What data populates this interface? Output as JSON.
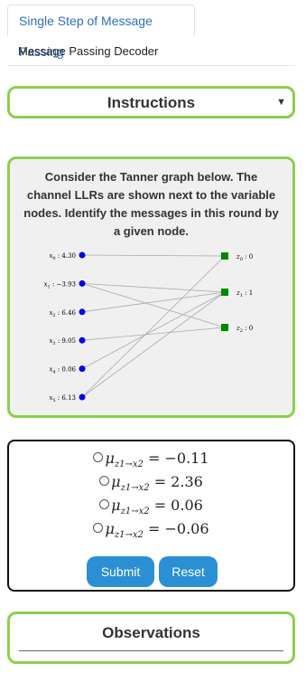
{
  "tabs": {
    "active": "Single Step of Message Passing",
    "inactive": "Message Passing Decoder"
  },
  "instructions": {
    "title": "Instructions"
  },
  "question": {
    "text": "Consider the Tanner graph below. The channel LLRs are shown next to the variable nodes. Identify the messages in this round by a given node."
  },
  "graph": {
    "variable_nodes": [
      {
        "label": "x",
        "sub": "0",
        "value": ": 4.30"
      },
      {
        "label": "x",
        "sub": "1",
        "value": ": −3.93"
      },
      {
        "label": "x",
        "sub": "2",
        "value": ": 6.46"
      },
      {
        "label": "x",
        "sub": "3",
        "value": ": 9.05"
      },
      {
        "label": "x",
        "sub": "4",
        "value": ": 0.06"
      },
      {
        "label": "x",
        "sub": "5",
        "value": ": 6.13"
      }
    ],
    "check_nodes": [
      {
        "label": "z",
        "sub": "0",
        "value": ": 0"
      },
      {
        "label": "z",
        "sub": "1",
        "value": ": 1"
      },
      {
        "label": "z",
        "sub": "2",
        "value": ": 0"
      }
    ],
    "edges": [
      [
        0,
        0
      ],
      [
        1,
        1
      ],
      [
        1,
        2
      ],
      [
        2,
        1
      ],
      [
        3,
        2
      ],
      [
        4,
        1
      ],
      [
        5,
        0
      ],
      [
        5,
        1
      ]
    ],
    "colors": {
      "variable": "#0000ee",
      "check": "#008800",
      "edge": "#aaaaaa"
    }
  },
  "answers": {
    "options": [
      {
        "prefix": "μ",
        "sub": "z1→x2",
        "value": "= −0.11"
      },
      {
        "prefix": "μ",
        "sub": "z1→x2",
        "value": "= 2.36"
      },
      {
        "prefix": "μ",
        "sub": "z1→x2",
        "value": "= 0.06"
      },
      {
        "prefix": "μ",
        "sub": "z1→x2",
        "value": "= −0.06"
      }
    ],
    "submit": "Submit",
    "reset": "Reset"
  },
  "observations": {
    "title": "Observations"
  }
}
